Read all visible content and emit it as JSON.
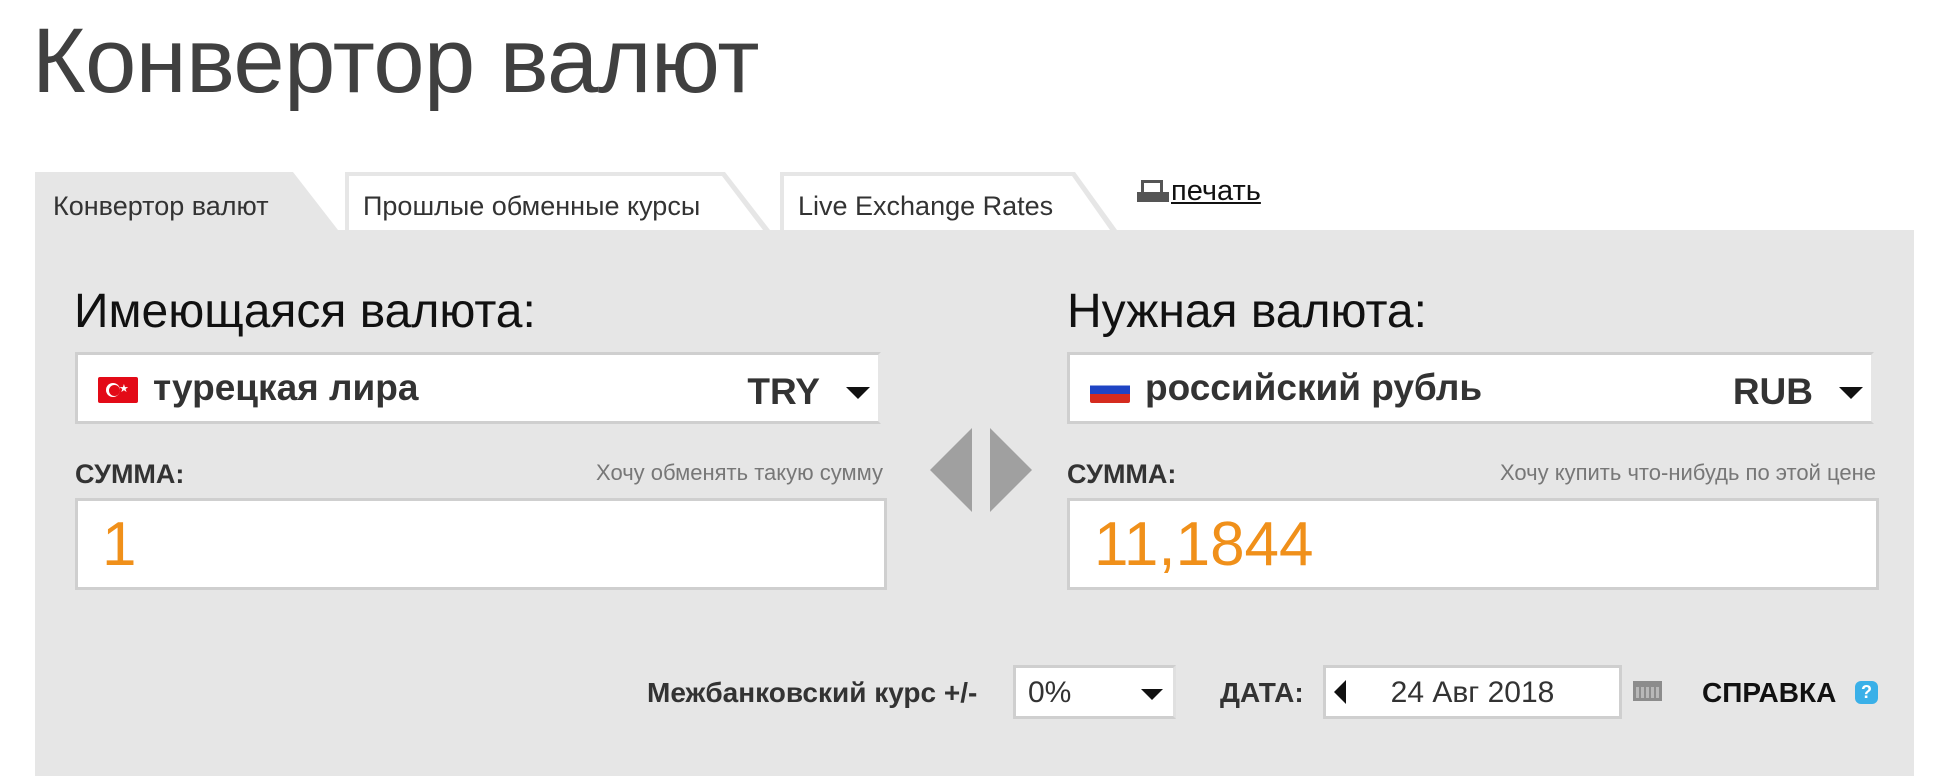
{
  "page": {
    "title": "Конвертор валют"
  },
  "tabs": [
    {
      "label": "Конвертор валют",
      "active": true
    },
    {
      "label": "Прошлые обменные курсы",
      "active": false
    },
    {
      "label": "Live Exchange Rates",
      "active": false
    }
  ],
  "print": {
    "label": "печать",
    "icon": "printer-icon"
  },
  "from": {
    "heading": "Имеющаяся валюта:",
    "currency_name": "турецкая лира",
    "currency_code": "TRY",
    "flag": "turkey-flag-icon",
    "amount_label": "СУММА:",
    "amount_hint": "Хочу обменять такую сумму",
    "amount_value": "1"
  },
  "to": {
    "heading": "Нужная валюта:",
    "currency_name": "российский рубль",
    "currency_code": "RUB",
    "flag": "russia-flag-icon",
    "amount_label": "СУММА:",
    "amount_hint": "Хочу купить что-нибудь по этой цене",
    "amount_value": "11,1844"
  },
  "swap": {
    "icon": "swap-arrows-icon"
  },
  "options": {
    "interbank_label": "Межбанковский курс +/-",
    "interbank_value": "0%",
    "date_label": "ДАТА:",
    "date_value": "24 Авг 2018",
    "help_label": "СПРАВКА",
    "help_icon": "?"
  },
  "colors": {
    "amount": "#f0901a",
    "panel": "#e6e6e6",
    "help_icon": "#3ab0e8",
    "swap_arrows": "#a0a0a0"
  }
}
